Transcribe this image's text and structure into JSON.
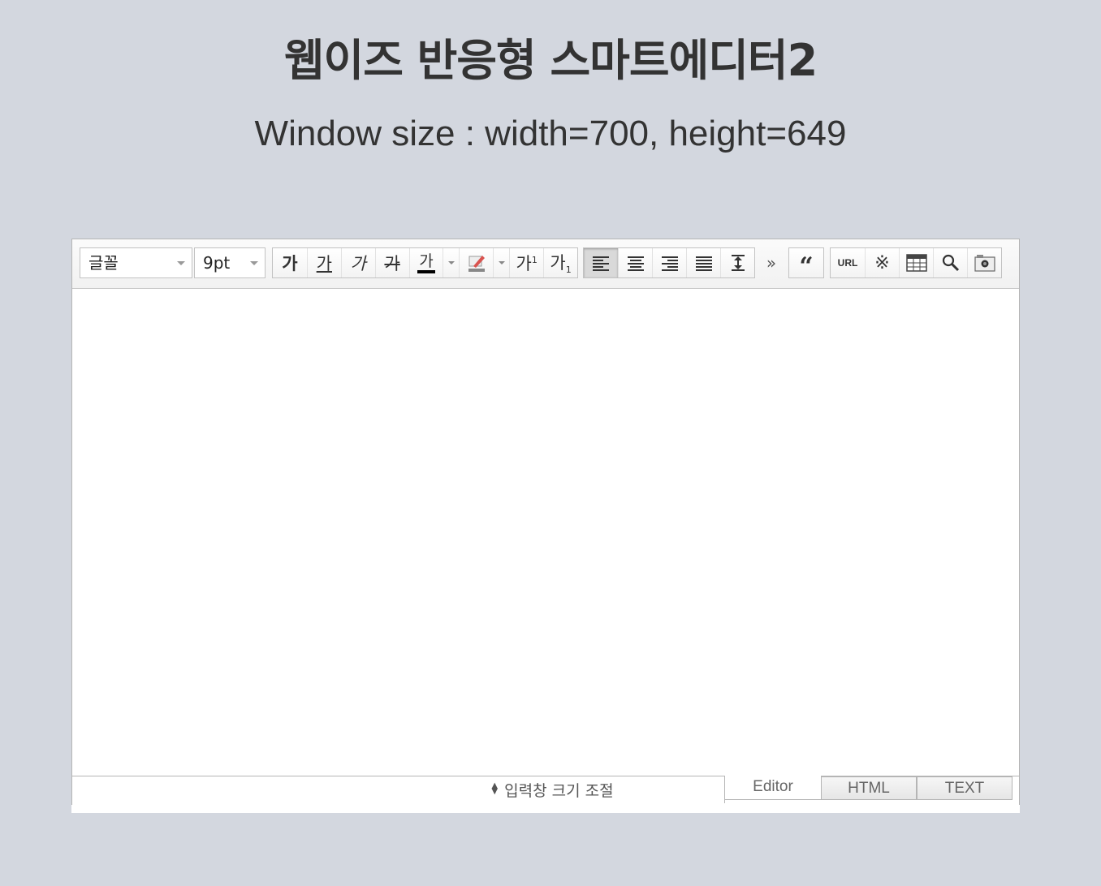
{
  "page": {
    "title": "웹이즈 반응형 스마트에디터2",
    "subtitle": "Window size : width=700, height=649"
  },
  "toolbar": {
    "font_select": "글꼴",
    "size_select": "9pt",
    "bold": "가",
    "underline": "가",
    "italic": "가",
    "strike": "가",
    "font_color": "가",
    "superscript": "가",
    "subscript": "가",
    "more": "»",
    "url": "URL"
  },
  "statusbar": {
    "resize_label": "입력창 크기 조절",
    "tabs": [
      "Editor",
      "HTML",
      "TEXT"
    ]
  }
}
